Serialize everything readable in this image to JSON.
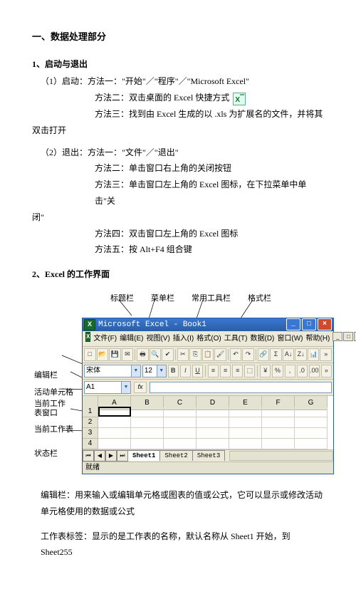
{
  "heading_main": "一、数据处理部分",
  "s1": {
    "head": "1、启动与退出",
    "p1": "（1）启动：方法一：\"开始\"／\"程序\"／\"Microsoft Excel\"",
    "p2": "方法二：双击桌面的 Excel 快捷方式",
    "p3a": "方法三：找到由 Excel 生成的以 .xls 为扩展名的文件，并将其",
    "p3b": "双击打开",
    "p4": "（2）退出：方法一：\"文件\"／\"退出\"",
    "p5": "方法二：单击窗口右上角的关闭按钮",
    "p6a": "方法三：单击窗口左上角的 Excel 图标，在下拉菜单中单击\"关",
    "p6b": "闭\"",
    "p7": "方法四：双击窗口左上角的 Excel 图标",
    "p8": "方法五：按 Alt+F4 组合键"
  },
  "s2": {
    "head": "2、Excel 的工作界面",
    "callouts_top": [
      "标题栏",
      "菜单栏",
      "常用工具栏",
      "格式栏"
    ],
    "callouts_left": {
      "l1": "编辑栏",
      "l2": "活动单元格",
      "l3a": "当前工作",
      "l3b": "表窗口",
      "l4": "当前工作表",
      "l5": "状态栏"
    }
  },
  "excel": {
    "title": "Microsoft Excel - Book1",
    "menus": [
      "文件(F)",
      "编辑(E)",
      "视图(V)",
      "插入(I)",
      "格式(O)",
      "工具(T)",
      "数据(D)",
      "窗口(W)",
      "帮助(H)"
    ],
    "font_name": "宋体",
    "font_size": "12",
    "name_box": "A1",
    "cols": [
      "A",
      "B",
      "C",
      "D",
      "E",
      "F",
      "G"
    ],
    "rows": [
      "1",
      "2",
      "3",
      "4"
    ],
    "tabs": [
      "Sheet1",
      "Sheet2",
      "Sheet3"
    ],
    "status": "就绪"
  },
  "footer": {
    "p1": "编辑栏：用来输入或编辑单元格或图表的值或公式，它可以显示或修改活动单元格使用的数据或公式",
    "p2": "工作表标签：显示的是工作表的名称，默认名称从 Sheet1 开始，到 Sheet255"
  }
}
